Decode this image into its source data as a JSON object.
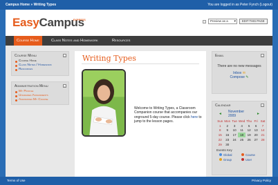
{
  "topbar": {
    "breadcrumb": "Campus Home » Writing Types",
    "login_text": "You are logged in as Peter Fynch (Logout)"
  },
  "header": {
    "logo_easy": "Easy",
    "logo_campus": "Campus",
    "logo_express": "EXPRESS",
    "preview_select": "Preview as a",
    "edit_button": "EDIT THIS PAGE"
  },
  "nav": {
    "tabs": [
      "Course Home",
      "Class Notes and Homework",
      "Resources"
    ]
  },
  "course_menu": {
    "title": "Course Menu",
    "items": [
      "Course Home",
      "Class Notes / Homework",
      "Resources"
    ]
  },
  "admin_menu": {
    "title": "Administration Menu",
    "items": [
      "My Profile",
      "Ungraded Assignments",
      "Administer My Course"
    ]
  },
  "main": {
    "title": "Writing Types",
    "body_before": "Welcome to Writing Types, a Classroom Companion course that accompanies our onground 5-day course. Please click ",
    "link": "here",
    "body_after": " to jump to the lesson pages."
  },
  "email": {
    "title": "Email",
    "message": "There are no new messages",
    "inbox": "Inbox",
    "compose": "Compose"
  },
  "calendar": {
    "title": "Calendar",
    "month": "November 2009",
    "prev": "◄",
    "next": "►",
    "weekdays": [
      "Sun",
      "Mon",
      "Tue",
      "Wed",
      "Thu",
      "Fri",
      "Sat"
    ],
    "weeks": [
      [
        "1",
        "2",
        "3",
        "4",
        "5",
        "6",
        "7"
      ],
      [
        "8",
        "9",
        "10",
        "11",
        "12",
        "13",
        "14"
      ],
      [
        "15",
        "16",
        "17",
        "18",
        "19",
        "20",
        "21"
      ],
      [
        "22",
        "23",
        "24",
        "25",
        "26",
        "27",
        "28"
      ],
      [
        "29",
        "30",
        "",
        "",
        "",
        "",
        ""
      ]
    ],
    "today": "18",
    "events_key_label": "Events Key",
    "keys": [
      {
        "label": "Global",
        "color": "#4a8de0"
      },
      {
        "label": "Course",
        "color": "#e65c1c"
      },
      {
        "label": "Group",
        "color": "#e6a01c"
      },
      {
        "label": "User",
        "color": "#c03030"
      }
    ]
  },
  "footer": {
    "terms": "Terms of Use",
    "privacy": "Privacy Policy"
  },
  "colors": {
    "accent": "#e65c1c",
    "frame_blue": "#2a6db5",
    "nav_dark": "#3d3d3d"
  }
}
